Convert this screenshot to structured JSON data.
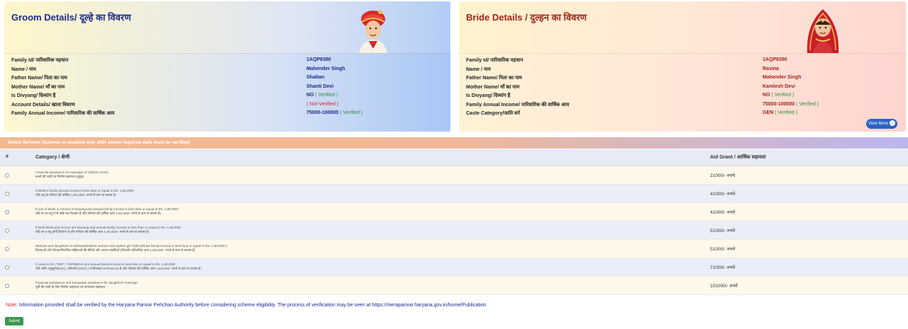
{
  "groom": {
    "title": "Groom Details/ दूल्हे का विवरण",
    "rows": [
      {
        "label": "Family Id/ पारिवारिक पहचान",
        "value": "1AQP8380",
        "status": ""
      },
      {
        "label": "Name / नाम",
        "value": "Mahender Singh",
        "status": ""
      },
      {
        "label": "Father Name/ पिता का नाम",
        "value": "Shaltan",
        "status": ""
      },
      {
        "label": "Mother Name/ माँ का नाम",
        "value": "Shanti Devi",
        "status": ""
      },
      {
        "label": "Is Divyang/ दिव्यांग है",
        "value": "NO",
        "status": "( Verified )"
      },
      {
        "label": "Account Details/ खाता विवरण",
        "value": "",
        "status": "( Not-Verified )"
      },
      {
        "label": "Family Annual Income/ पारिवारिक की वार्षिक आय",
        "value": "75000-100000",
        "status": "( Verified )"
      }
    ]
  },
  "bride": {
    "title": "Bride Details / दुल्हन का विवरण",
    "rows": [
      {
        "label": "Family Id/ पारिवारिक पहचान",
        "value": "1AQP8380",
        "status": ""
      },
      {
        "label": "Name / नाम",
        "value": "Ravina",
        "status": ""
      },
      {
        "label": "Father Name/ पिता का नाम",
        "value": "Mahender Singh",
        "status": ""
      },
      {
        "label": "Mother Name/ माँ का नाम",
        "value": "Kamlesh Devi",
        "status": ""
      },
      {
        "label": "Is Divyang/ दिव्यांग है",
        "value": "NO",
        "status": "( Verified )"
      },
      {
        "label": "Family Annual Income/ पारिवारिक की वार्षिक आय",
        "value": "75000-100000",
        "status": "( Verified )"
      },
      {
        "label": "Caste Category/जाति वर्ग",
        "value": "GEN",
        "status": "( Verified )"
      }
    ],
    "view_more_label": "View More"
  },
  "scheme": {
    "bar_title": "Select Scheme [Scheme is enabled only after above required data must be verified]",
    "col_index": "#",
    "col_category": "Category / श्रेणी",
    "col_aid": "Aid Grant / आर्थिक सहायता",
    "rows": [
      {
        "line1": "Financial assistance on marriage of children (Gen)",
        "line2": "बच्चों की शादी पर वित्तीय सहायता (सुदृढ़)",
        "amount": "21000/- रुपये"
      },
      {
        "line1": "If Bride's family annual income is less than or equal to Rs. 1,80,000/-",
        "line2": "यदि वधू के परिवार की वार्षिक 1,80,000/- रुपये से कम या बराबर है।",
        "amount": "41000/- रुपये"
      },
      {
        "line1": "If one of Bride or Groom is Divyang and annual family income is less than or equal to Rs. 1,80,000/-",
        "line2": "यदि वर या वधू में से कोई एक दिव्यांग है और परिवार की वार्षिक आय 1,80,000/- रुपये से कम या बराबर है।",
        "amount": "41000/- रुपये"
      },
      {
        "line1": "If Both Bride and Groom are Divyang and annual family income is less than or equal to Rs. 1,80,000/-",
        "line2": "यदि वर व वधू दोनों दिव्यांग हैं और परिवार की वार्षिक आय 1,80,000/- रुपये से कम या बराबर है।",
        "amount": "51000/- रुपये"
      },
      {
        "line1": "Widows and daughters of widows/destitute women and orphan girl child (whose family income is less than or equal to Rs. 1,80,000/-)",
        "line2": "विधवाओं और विधवा/निराश्रित महिलाओं की बेटियों और अनाथ लड़कियों (जिनकी पारिवारिक आय 1,80,000/- रुपये से कम या बराबर है)",
        "amount": "51000/- रुपये"
      },
      {
        "line1": "If caste is SC / DNT / TAPRIWAS and annual family income is less than or equal to Rs. 1,80,000/-",
        "line2": "यदि जाति अनुसूचित(SC) / डीएनटी (DNT) / टपरीवास(TAPRIWAS) है और परिवार की वार्षिक आय 1,80,000/- रुपये से कम या बराबर है।",
        "amount": "71000/- रुपये"
      },
      {
        "line1": "Financial assistance and Kanyadan assistance for daughter's marriage",
        "line2": "पुत्री की शादी के लिए वित्तीय सहायता एवं कन्यादान सहायता",
        "amount": "101000/- रुपये"
      }
    ]
  },
  "note": {
    "prefix": "Note",
    "text": ": Information provided shall be verified by the Haryana Parivar Pehchan Authority before considering scheme eligibility. The process of verification may be seen at https://meraparivar.haryana.gov.in/home/Publication"
  },
  "submit_label": "Submit",
  "colors": {
    "groom_title": "#1b2a8a",
    "bride_title": "#a32418",
    "verified": "#2e8b3a",
    "not_verified": "#d12a2a",
    "submit": "#3b9a4a",
    "view_more": "#2a63c4"
  }
}
